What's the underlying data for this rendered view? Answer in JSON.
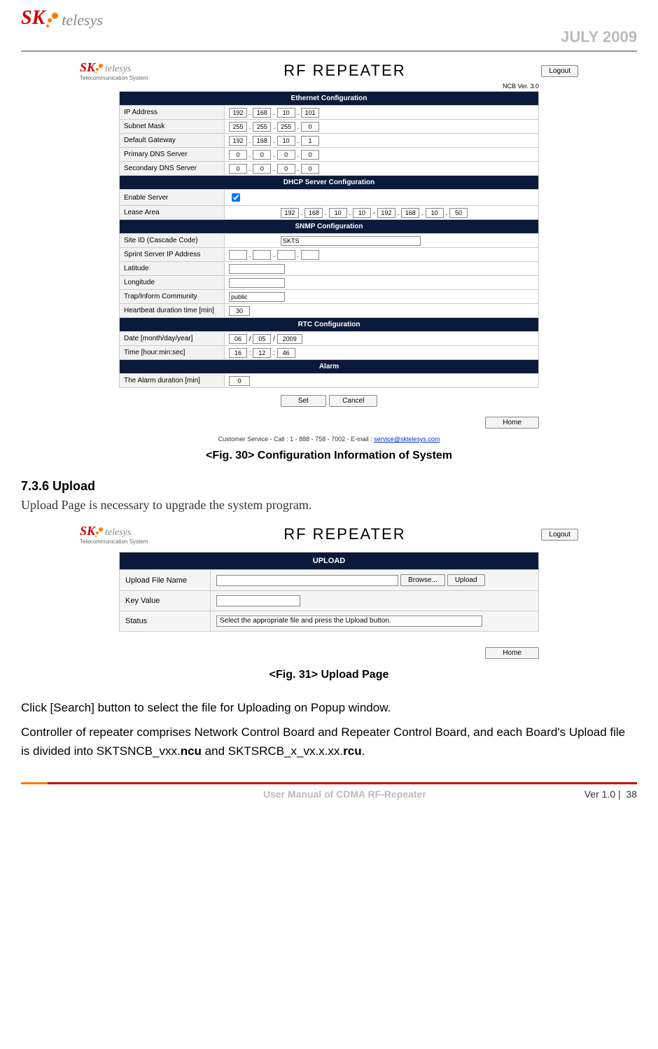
{
  "header": {
    "brand_sk": "SK",
    "brand_telesys": "telesys",
    "date": "JULY 2009"
  },
  "fig30": {
    "brand_sk": "SK",
    "brand_telesys": "telesys",
    "brand_sub": "Telecommunication System",
    "title": "RF  REPEATER",
    "logout": "Logout",
    "ncb_label": "NCB Ver.",
    "ncb_ver": "3.0",
    "sec_eth": "Ethernet Configuration",
    "lbl_ip": "IP Address",
    "ip": [
      "192",
      "168",
      "10",
      "101"
    ],
    "lbl_subnet": "Subnet Mask",
    "subnet": [
      "255",
      "255",
      "255",
      "0"
    ],
    "lbl_gw": "Default Gateway",
    "gw": [
      "192",
      "168",
      "10",
      "1"
    ],
    "lbl_pdns": "Primary DNS Server",
    "pdns": [
      "0",
      "0",
      "0",
      "0"
    ],
    "lbl_sdns": "Secondary DNS Server",
    "sdns": [
      "0",
      "0",
      "0",
      "0"
    ],
    "sec_dhcp": "DHCP Server Configuration",
    "lbl_enable": "Enable Server",
    "lbl_lease": "Lease Area",
    "lease_a": [
      "192",
      "168",
      "10",
      "10"
    ],
    "lease_b": [
      "192",
      "168",
      "10",
      "50"
    ],
    "sec_snmp": "SNMP Configuration",
    "lbl_site": "Site ID (Cascade Code)",
    "site": "SKTS",
    "lbl_sprint": "Sprint Server IP Address",
    "sprint": [
      "",
      "",
      "",
      ""
    ],
    "lbl_lat": "Latitude",
    "lat": "",
    "lbl_lon": "Longitude",
    "lon": "",
    "lbl_trap": "Trap/Inform Community",
    "trap": "public",
    "lbl_hb": "Heartbeat duration time [min]",
    "hb": "30",
    "sec_rtc": "RTC Configuration",
    "lbl_date": "Date [month/day/year]",
    "date": [
      "06",
      "05",
      "2009"
    ],
    "lbl_time": "Time [hour:min:sec]",
    "time": [
      "16",
      "12",
      "46"
    ],
    "sec_alarm": "Alarm",
    "lbl_alarm": "The Alarm duration [min]",
    "alarm": "0",
    "btn_set": "Set",
    "btn_cancel": "Cancel",
    "btn_home": "Home",
    "cs_prefix": "Customer Service  -  Call : 1 - 888 - 758 - 7002  -  E-mail : ",
    "cs_email": "service@sktelesys.com",
    "caption": "<Fig. 30> Configuration Information of System"
  },
  "section": {
    "heading": "7.3.6 Upload",
    "body": "Upload Page is necessary to upgrade the system program."
  },
  "fig31": {
    "brand_sk": "SK",
    "brand_telesys": "telesys",
    "brand_sub": "Telecommunication System",
    "title": "RF  REPEATER",
    "logout": "Logout",
    "sec_upload": "UPLOAD",
    "lbl_file": "Upload File Name",
    "btn_browse": "Browse...",
    "btn_upload": "Upload",
    "lbl_key": "Key Value",
    "key": "",
    "lbl_status": "Status",
    "status_msg": "Select the appropriate file and press the Upload button.",
    "btn_home": "Home",
    "caption": "<Fig. 31> Upload Page"
  },
  "paragraph": {
    "line1": "Click [Search] button to select the file for Uploading on Popup window.",
    "line2a": "Controller of repeater comprises Network Control Board and Repeater Control Board, and each Board's Upload file is divided into SKTSNCB_vxx.",
    "line2b": "ncu",
    "line2c": " and SKTSRCB_x_vx.x.xx.",
    "line2d": "rcu",
    "line2e": "."
  },
  "footer": {
    "center": "User Manual of CDMA RF-Repeater",
    "ver": "Ver 1.0 |",
    "page": "38"
  }
}
